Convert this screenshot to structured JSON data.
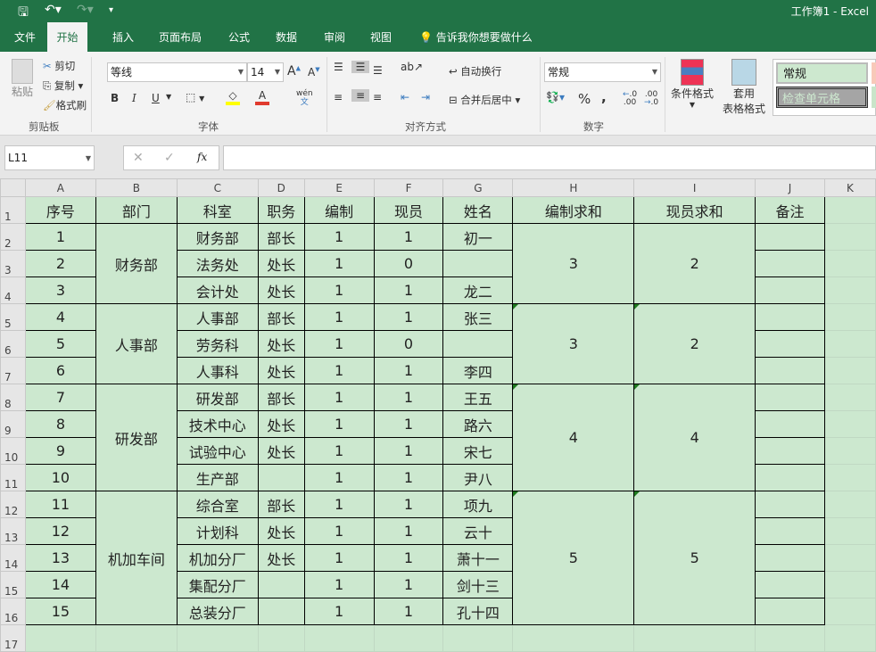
{
  "app": {
    "title": "工作簿1  -  Excel"
  },
  "tabs": [
    "文件",
    "开始",
    "插入",
    "页面布局",
    "公式",
    "数据",
    "审阅",
    "视图"
  ],
  "tell_me": "告诉我你想要做什么",
  "clipboard": {
    "paste": "粘贴",
    "cut": "剪切",
    "copy": "复制",
    "format_painter": "格式刷",
    "label": "剪贴板"
  },
  "font": {
    "name": "等线",
    "size": "14",
    "label": "字体",
    "bold": "B",
    "italic": "I",
    "underline": "U",
    "phonetic": "wén"
  },
  "alignment": {
    "wrap": "自动换行",
    "merge": "合并后居中",
    "label": "对齐方式"
  },
  "number": {
    "format": "常规",
    "percent": "%",
    "comma": ",",
    "inc": ".00",
    "dec": ".0",
    "label": "数字"
  },
  "styles": {
    "conditional": "条件格式",
    "table_fmt1": "套用",
    "table_fmt2": "表格格式",
    "normal": "常规",
    "check": "检查单元格"
  },
  "formula_bar": {
    "name_box": "L11",
    "fx": "fx",
    "value": ""
  },
  "colors": {
    "green": "#217346",
    "cell_bg": "#cce8cf"
  },
  "columns": [
    "A",
    "B",
    "C",
    "D",
    "E",
    "F",
    "G",
    "H",
    "I",
    "J",
    "K"
  ],
  "headers": [
    "序号",
    "部门",
    "科室",
    "职务",
    "编制",
    "现员",
    "姓名",
    "编制求和",
    "现员求和",
    "备注"
  ],
  "rows": [
    [
      "1",
      "财务部",
      "财务部",
      "部长",
      "1",
      "1",
      "初一",
      "3",
      "2"
    ],
    [
      "2",
      "",
      "法务处",
      "处长",
      "1",
      "0",
      "",
      "",
      ""
    ],
    [
      "3",
      "",
      "会计处",
      "处长",
      "1",
      "1",
      "龙二",
      "",
      ""
    ],
    [
      "4",
      "人事部",
      "人事部",
      "部长",
      "1",
      "1",
      "张三",
      "3",
      "2"
    ],
    [
      "5",
      "",
      "劳务科",
      "处长",
      "1",
      "0",
      "",
      "",
      ""
    ],
    [
      "6",
      "",
      "人事科",
      "处长",
      "1",
      "1",
      "李四",
      "",
      ""
    ],
    [
      "7",
      "研发部",
      "研发部",
      "部长",
      "1",
      "1",
      "王五",
      "4",
      "4"
    ],
    [
      "8",
      "",
      "技术中心",
      "处长",
      "1",
      "1",
      "路六",
      "",
      ""
    ],
    [
      "9",
      "",
      "试验中心",
      "处长",
      "1",
      "1",
      "宋七",
      "",
      ""
    ],
    [
      "10",
      "",
      "生产部",
      "",
      "1",
      "1",
      "尹八",
      "",
      ""
    ],
    [
      "11",
      "机加车间",
      "综合室",
      "部长",
      "1",
      "1",
      "项九",
      "5",
      "5"
    ],
    [
      "12",
      "",
      "计划科",
      "处长",
      "1",
      "1",
      "云十",
      "",
      ""
    ],
    [
      "13",
      "",
      "机加分厂",
      "处长",
      "1",
      "1",
      "萧十一",
      "",
      ""
    ],
    [
      "14",
      "",
      "集配分厂",
      "",
      "1",
      "1",
      "剑十三",
      "",
      ""
    ],
    [
      "15",
      "",
      "总装分厂",
      "",
      "1",
      "1",
      "孔十四",
      "",
      ""
    ]
  ],
  "groups": [
    3,
    3,
    4,
    5
  ]
}
